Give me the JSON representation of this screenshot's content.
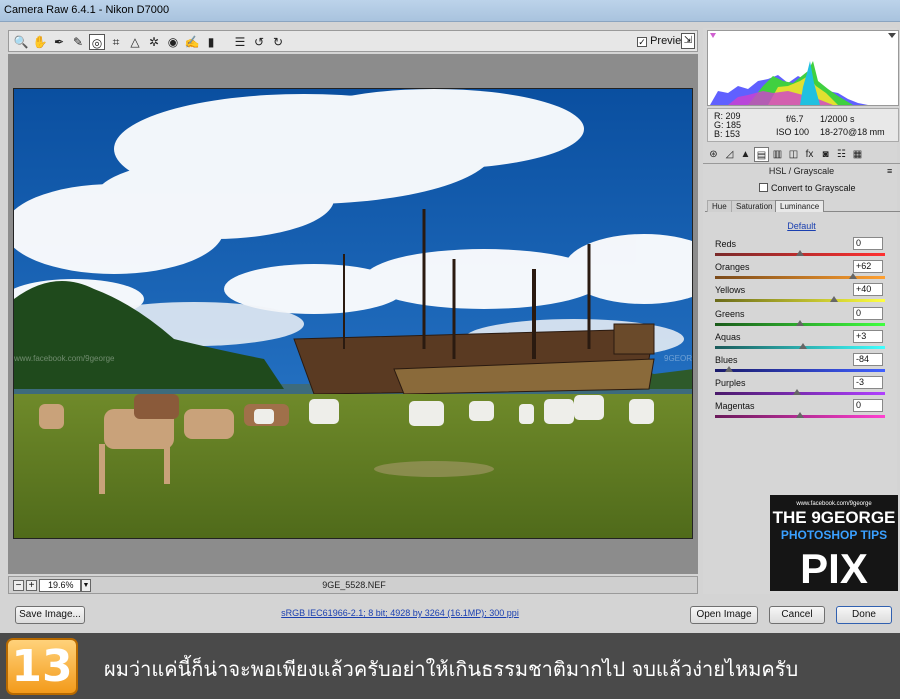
{
  "window": {
    "title": "Camera Raw 6.4.1  -  Nikon D7000"
  },
  "toolbar": {
    "tools": [
      {
        "name": "zoom-tool-icon",
        "glyph": "🔍"
      },
      {
        "name": "hand-tool-icon",
        "glyph": "✋"
      },
      {
        "name": "white-balance-tool-icon",
        "glyph": "✒"
      },
      {
        "name": "color-sampler-tool-icon",
        "glyph": "✎"
      },
      {
        "name": "targeted-adjustment-tool-icon",
        "glyph": "◎"
      },
      {
        "name": "crop-tool-icon",
        "glyph": "⌗"
      },
      {
        "name": "straighten-tool-icon",
        "glyph": "△"
      },
      {
        "name": "spot-removal-tool-icon",
        "glyph": "✲"
      },
      {
        "name": "red-eye-tool-icon",
        "glyph": "◉"
      },
      {
        "name": "adjustment-brush-icon",
        "glyph": "✍"
      },
      {
        "name": "graduated-filter-icon",
        "glyph": "▮"
      },
      {
        "name": "preferences-icon",
        "glyph": "☰"
      },
      {
        "name": "rotate-left-icon",
        "glyph": "↺"
      },
      {
        "name": "rotate-right-icon",
        "glyph": "↻"
      }
    ],
    "preview_label": "Preview",
    "preview_checked": "✓"
  },
  "status": {
    "zoom": "19.6%",
    "filename": "9GE_5528.NEF"
  },
  "bottom": {
    "save_label": "Save Image...",
    "workflow": "sRGB IEC61966-2.1; 8 bit; 4928 by 3264 (16.1MP); 300 ppi",
    "open_label": "Open Image",
    "cancel_label": "Cancel",
    "done_label": "Done"
  },
  "readout": {
    "r": "R:   209",
    "g": "G:   185",
    "b": "B:   153",
    "aperture": "f/6.7",
    "shutter": "1/2000 s",
    "iso": "ISO 100",
    "lens": "18-270@18 mm"
  },
  "panel": {
    "title": "HSL / Grayscale",
    "convert_label": "Convert to Grayscale",
    "tabs": [
      "Hue",
      "Saturation",
      "Luminance"
    ],
    "active_tab": "Luminance",
    "default_label": "Default",
    "sliders": [
      {
        "label": "Reds",
        "value": "0",
        "num": 0,
        "track": "linear-gradient(90deg,#7a2a2a,#ff3030)"
      },
      {
        "label": "Oranges",
        "value": "+62",
        "num": 62,
        "track": "linear-gradient(90deg,#7a4a1a,#ffa030)"
      },
      {
        "label": "Yellows",
        "value": "+40",
        "num": 40,
        "track": "linear-gradient(90deg,#6a6a1a,#ffff40)"
      },
      {
        "label": "Greens",
        "value": "0",
        "num": 0,
        "track": "linear-gradient(90deg,#1a5a1a,#40ff40)"
      },
      {
        "label": "Aquas",
        "value": "+3",
        "num": 3,
        "track": "linear-gradient(90deg,#1a5a5a,#40ffff)"
      },
      {
        "label": "Blues",
        "value": "-84",
        "num": -84,
        "track": "linear-gradient(90deg,#1a1a6a,#4060ff)"
      },
      {
        "label": "Purples",
        "value": "-3",
        "num": -3,
        "track": "linear-gradient(90deg,#4a1a6a,#b040ff)"
      },
      {
        "label": "Magentas",
        "value": "0",
        "num": 0,
        "track": "linear-gradient(90deg,#6a1a5a,#ff40d0)"
      }
    ]
  },
  "logo": {
    "url": "www.facebook.com/9george",
    "line1": "THE 9GEORGE",
    "line2": "PHOTOSHOP TIPS",
    "line3": "PIX"
  },
  "banner": {
    "step": "13",
    "caption": "ผมว่าแค่นี้ก็น่าจะพอเพียงแล้วครับอย่าให้เกินธรรมชาติมากไป จบแล้วง่ายไหมครับ"
  }
}
